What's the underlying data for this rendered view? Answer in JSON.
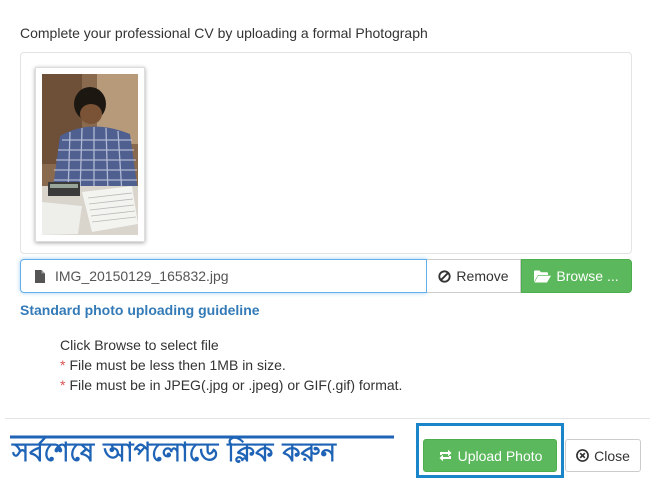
{
  "instruction": "Complete your professional CV by uploading a formal Photograph",
  "preview": {
    "photo_alt": "Uploaded photograph preview"
  },
  "file_input": {
    "filename": "IMG_20150129_165832.jpg",
    "file_icon": "file-icon",
    "remove_label": "Remove",
    "remove_icon": "ban-icon",
    "browse_label": "Browse ...",
    "browse_icon": "folder-open-icon"
  },
  "guidelines": {
    "title": "Standard photo uploading guideline",
    "intro": "Click Browse to select file",
    "rules": [
      "File must be less then 1MB in size.",
      "File must be in JPEG(.jpg or .jpeg) or GIF(.gif) format."
    ]
  },
  "footer": {
    "handwritten_note": "সর্বশেষে আপলোডে ক্লিক করুন",
    "upload_label": "Upload Photo",
    "upload_icon": "refresh-icon",
    "close_label": "Close",
    "close_icon": "times-circle-icon"
  },
  "colors": {
    "primary_link": "#337ab7",
    "success": "#5cb85c",
    "required_star": "#d9534f",
    "highlight_border": "#1a85c9",
    "handwritten": "#1e63b6"
  }
}
